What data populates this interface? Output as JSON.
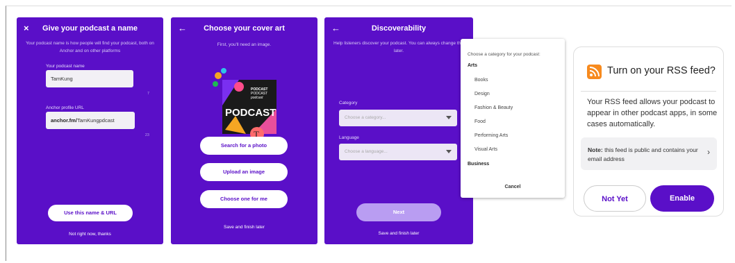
{
  "panel1": {
    "close_icon": "×",
    "title": "Give your podcast a name",
    "subtitle": "Your podcast name is how people will find your podcast, both on Anchor and on other platforms",
    "name_label": "Your podcast name",
    "name_value": "TamKung",
    "name_count": "7",
    "url_label": "Anchor profile URL",
    "url_prefix": "anchor.fm/",
    "url_value": "TamKungpdcast",
    "url_count": "23",
    "primary_button": "Use this name & URL",
    "secondary_link": "Not right now, thanks"
  },
  "panel2": {
    "back_icon": "←",
    "title": "Choose your cover art",
    "subtitle": "First, you'll need an image.",
    "art_text": "PODCAST",
    "art_small": [
      "PODCAST",
      "PODCAST",
      "podcast"
    ],
    "art_letter": "T",
    "buttons": [
      "Search for a photo",
      "Upload an image",
      "Choose one for me"
    ],
    "footer_link": "Save and finish later"
  },
  "panel3": {
    "back_icon": "←",
    "title": "Discoverability",
    "subtitle": "Help listeners discover your podcast. You can always change this later.",
    "category_label": "Category",
    "category_placeholder": "Choose a category...",
    "language_label": "Language",
    "language_placeholder": "Choose a language...",
    "next_button": "Next",
    "footer_link": "Save and finish later"
  },
  "dropdown": {
    "title": "Choose a category for your podcast:",
    "groups": [
      {
        "name": "Arts",
        "items": [
          "Books",
          "Design",
          "Fashion & Beauty",
          "Food",
          "Performing Arts",
          "Visual Arts"
        ]
      },
      {
        "name": "Business",
        "items": []
      }
    ],
    "cancel": "Cancel"
  },
  "rss": {
    "icon": "rss-icon",
    "title": "Turn on your RSS feed?",
    "body": "Your RSS feed allows your podcast to appear in other podcast apps, in some cases automatically.",
    "note_bold": "Note:",
    "note_text": " this feed is public and contains your email address",
    "chevron": "›",
    "not_yet": "Not Yet",
    "enable": "Enable"
  },
  "colors": {
    "brand_purple": "#5a0fc8",
    "rss_orange": "#f78a1e"
  }
}
